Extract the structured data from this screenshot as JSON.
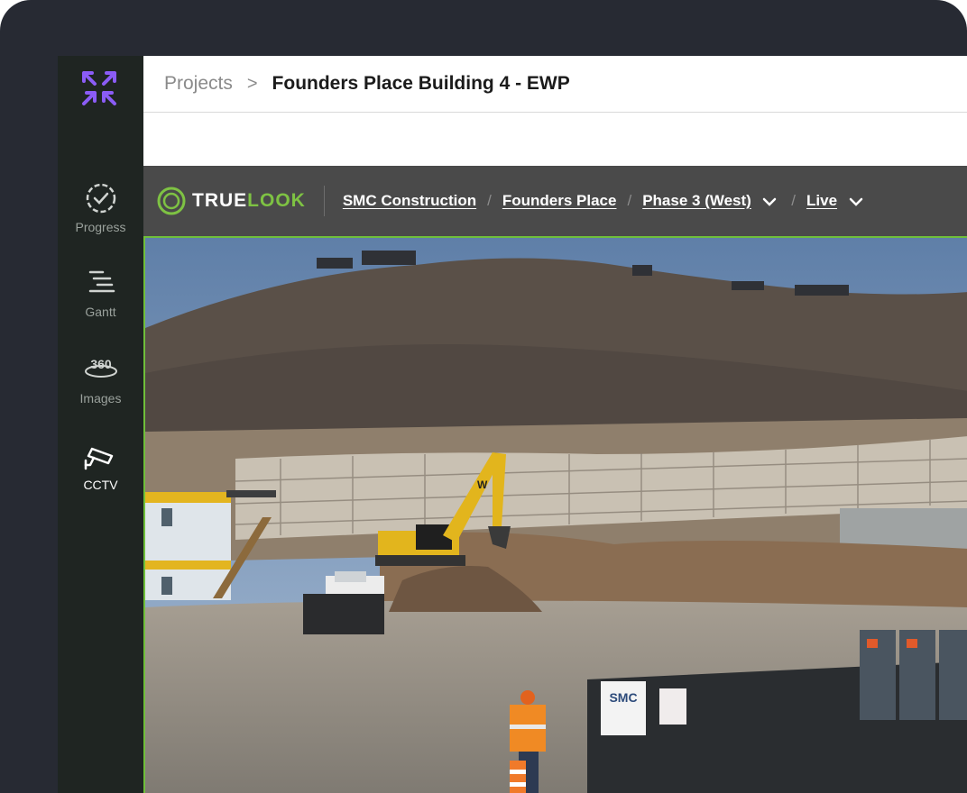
{
  "sidebar": {
    "items": [
      {
        "label": "Progress",
        "icon": "progress-check-icon",
        "active": false
      },
      {
        "label": "Gantt",
        "icon": "gantt-icon",
        "active": false
      },
      {
        "label": "Images",
        "icon": "360-images-icon",
        "active": false
      },
      {
        "label": "CCTV",
        "icon": "cctv-camera-icon",
        "active": true
      }
    ],
    "brand_icon": "app-logo-icon"
  },
  "header": {
    "breadcrumb_root": "Projects",
    "breadcrumb_separator": ">",
    "title": "Founders Place Building 4 - EWP"
  },
  "camera_bar": {
    "brand_true": "TRUE",
    "brand_look": "LOOK",
    "links": [
      "SMC Construction",
      "Founders Place",
      "Phase 3 (West)",
      "Live"
    ],
    "separator": "/"
  },
  "feed": {
    "sign_text": "SMC",
    "excavator_text": "W"
  },
  "colors": {
    "frame": "#272a33",
    "sidebar": "#1f2522",
    "accent_purple": "#8b5cf6",
    "truelook_green": "#7ec243",
    "camera_bar": "#4a4a4a"
  }
}
